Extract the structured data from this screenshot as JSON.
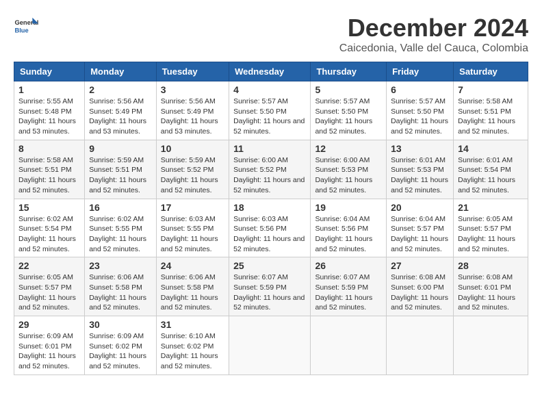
{
  "header": {
    "logo_line1": "General",
    "logo_line2": "Blue",
    "title": "December 2024",
    "subtitle": "Caicedonia, Valle del Cauca, Colombia"
  },
  "weekdays": [
    "Sunday",
    "Monday",
    "Tuesday",
    "Wednesday",
    "Thursday",
    "Friday",
    "Saturday"
  ],
  "weeks": [
    [
      {
        "day": 1,
        "sunrise": "5:55 AM",
        "sunset": "5:48 PM",
        "daylight": "11 hours and 53 minutes."
      },
      {
        "day": 2,
        "sunrise": "5:56 AM",
        "sunset": "5:49 PM",
        "daylight": "11 hours and 53 minutes."
      },
      {
        "day": 3,
        "sunrise": "5:56 AM",
        "sunset": "5:49 PM",
        "daylight": "11 hours and 53 minutes."
      },
      {
        "day": 4,
        "sunrise": "5:57 AM",
        "sunset": "5:50 PM",
        "daylight": "11 hours and 52 minutes."
      },
      {
        "day": 5,
        "sunrise": "5:57 AM",
        "sunset": "5:50 PM",
        "daylight": "11 hours and 52 minutes."
      },
      {
        "day": 6,
        "sunrise": "5:57 AM",
        "sunset": "5:50 PM",
        "daylight": "11 hours and 52 minutes."
      },
      {
        "day": 7,
        "sunrise": "5:58 AM",
        "sunset": "5:51 PM",
        "daylight": "11 hours and 52 minutes."
      }
    ],
    [
      {
        "day": 8,
        "sunrise": "5:58 AM",
        "sunset": "5:51 PM",
        "daylight": "11 hours and 52 minutes."
      },
      {
        "day": 9,
        "sunrise": "5:59 AM",
        "sunset": "5:51 PM",
        "daylight": "11 hours and 52 minutes."
      },
      {
        "day": 10,
        "sunrise": "5:59 AM",
        "sunset": "5:52 PM",
        "daylight": "11 hours and 52 minutes."
      },
      {
        "day": 11,
        "sunrise": "6:00 AM",
        "sunset": "5:52 PM",
        "daylight": "11 hours and 52 minutes."
      },
      {
        "day": 12,
        "sunrise": "6:00 AM",
        "sunset": "5:53 PM",
        "daylight": "11 hours and 52 minutes."
      },
      {
        "day": 13,
        "sunrise": "6:01 AM",
        "sunset": "5:53 PM",
        "daylight": "11 hours and 52 minutes."
      },
      {
        "day": 14,
        "sunrise": "6:01 AM",
        "sunset": "5:54 PM",
        "daylight": "11 hours and 52 minutes."
      }
    ],
    [
      {
        "day": 15,
        "sunrise": "6:02 AM",
        "sunset": "5:54 PM",
        "daylight": "11 hours and 52 minutes."
      },
      {
        "day": 16,
        "sunrise": "6:02 AM",
        "sunset": "5:55 PM",
        "daylight": "11 hours and 52 minutes."
      },
      {
        "day": 17,
        "sunrise": "6:03 AM",
        "sunset": "5:55 PM",
        "daylight": "11 hours and 52 minutes."
      },
      {
        "day": 18,
        "sunrise": "6:03 AM",
        "sunset": "5:56 PM",
        "daylight": "11 hours and 52 minutes."
      },
      {
        "day": 19,
        "sunrise": "6:04 AM",
        "sunset": "5:56 PM",
        "daylight": "11 hours and 52 minutes."
      },
      {
        "day": 20,
        "sunrise": "6:04 AM",
        "sunset": "5:57 PM",
        "daylight": "11 hours and 52 minutes."
      },
      {
        "day": 21,
        "sunrise": "6:05 AM",
        "sunset": "5:57 PM",
        "daylight": "11 hours and 52 minutes."
      }
    ],
    [
      {
        "day": 22,
        "sunrise": "6:05 AM",
        "sunset": "5:57 PM",
        "daylight": "11 hours and 52 minutes."
      },
      {
        "day": 23,
        "sunrise": "6:06 AM",
        "sunset": "5:58 PM",
        "daylight": "11 hours and 52 minutes."
      },
      {
        "day": 24,
        "sunrise": "6:06 AM",
        "sunset": "5:58 PM",
        "daylight": "11 hours and 52 minutes."
      },
      {
        "day": 25,
        "sunrise": "6:07 AM",
        "sunset": "5:59 PM",
        "daylight": "11 hours and 52 minutes."
      },
      {
        "day": 26,
        "sunrise": "6:07 AM",
        "sunset": "5:59 PM",
        "daylight": "11 hours and 52 minutes."
      },
      {
        "day": 27,
        "sunrise": "6:08 AM",
        "sunset": "6:00 PM",
        "daylight": "11 hours and 52 minutes."
      },
      {
        "day": 28,
        "sunrise": "6:08 AM",
        "sunset": "6:01 PM",
        "daylight": "11 hours and 52 minutes."
      }
    ],
    [
      {
        "day": 29,
        "sunrise": "6:09 AM",
        "sunset": "6:01 PM",
        "daylight": "11 hours and 52 minutes."
      },
      {
        "day": 30,
        "sunrise": "6:09 AM",
        "sunset": "6:02 PM",
        "daylight": "11 hours and 52 minutes."
      },
      {
        "day": 31,
        "sunrise": "6:10 AM",
        "sunset": "6:02 PM",
        "daylight": "11 hours and 52 minutes."
      },
      null,
      null,
      null,
      null
    ]
  ]
}
